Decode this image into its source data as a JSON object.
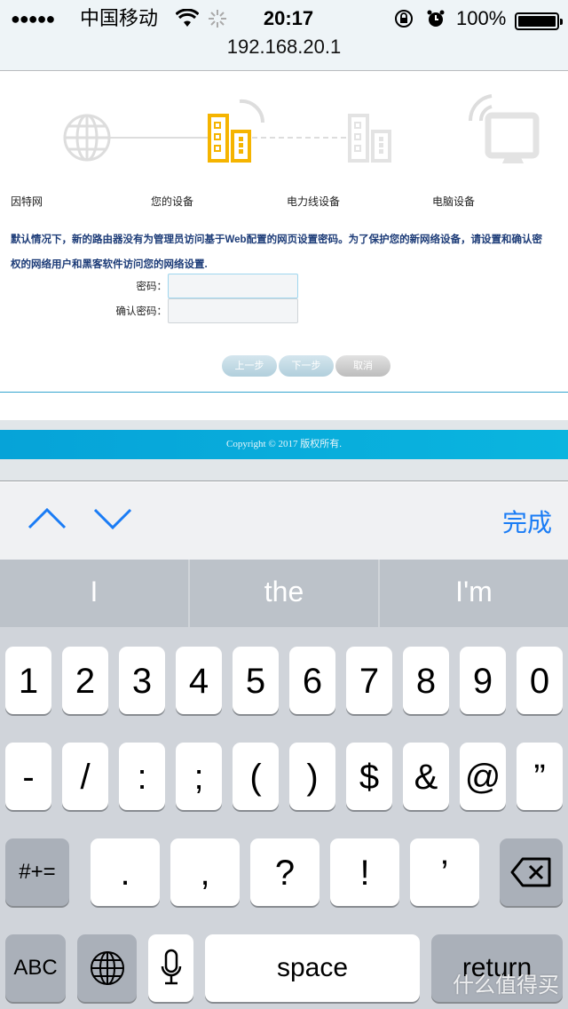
{
  "status_bar": {
    "signal": "●●●●●",
    "carrier": "中国移动",
    "time": "20:17",
    "battery_pct": "100%",
    "battery_level": 1.0
  },
  "browser": {
    "url": "192.168.20.1"
  },
  "wizard": {
    "steps": [
      {
        "label": "因特网",
        "icon": "globe-icon",
        "active": false
      },
      {
        "label": "您的设备",
        "icon": "powerline-adapter-icon",
        "active": true
      },
      {
        "label": "电力线设备",
        "icon": "powerline-adapter-icon",
        "active": false
      },
      {
        "label": "电脑设备",
        "icon": "computer-monitor-icon",
        "active": false
      }
    ],
    "description_line1": "默认情况下，新的路由器没有为管理员访问基于Web配置的网页设置密码。为了保护您的新网络设备，请设置和确认密",
    "description_line2": "权的网络用户和黑客软件访问您的网络设置.",
    "password_label": "密码：",
    "password_value": "",
    "confirm_label": "确认密码：",
    "confirm_value": "",
    "buttons": {
      "prev": "上一步",
      "next": "下一步",
      "cancel": "取消"
    },
    "colors": {
      "active": "#f5b400",
      "inactive": "#dddddd",
      "text": "#1d3c78"
    }
  },
  "footer": {
    "copyright": "Copyright © 2017 版权所有."
  },
  "accessory_bar": {
    "prev_icon": "chevron-up-icon",
    "next_icon": "chevron-down-icon",
    "done": "完成",
    "accent": "#1a7cf5"
  },
  "suggestions": [
    "I",
    "the",
    "I'm"
  ],
  "keyboard": {
    "row1": [
      "1",
      "2",
      "3",
      "4",
      "5",
      "6",
      "7",
      "8",
      "9",
      "0"
    ],
    "row2": [
      "-",
      "/",
      ":",
      ";",
      "(",
      ")",
      "$",
      "&",
      "@",
      "”"
    ],
    "row3_left": "#+=",
    "row3": [
      ".",
      ",",
      "?",
      "!",
      "’"
    ],
    "abc": "ABC",
    "space": "space",
    "return": "return"
  },
  "watermark": "什么值得买"
}
